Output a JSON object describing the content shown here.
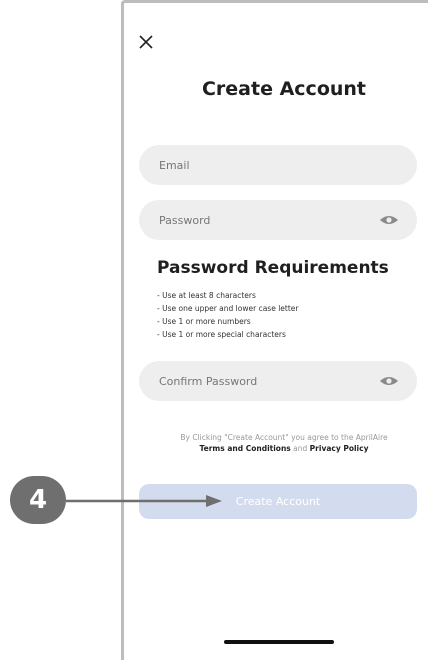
{
  "header": {
    "title": "Create Account"
  },
  "form": {
    "email_placeholder": "Email",
    "password_placeholder": "Password",
    "confirm_placeholder": "Confirm Password"
  },
  "requirements": {
    "title": "Password Requirements",
    "items": [
      "- Use at least 8 characters",
      "- Use one upper and lower case letter",
      "- Use 1 or more numbers",
      "- Use 1 or more special characters"
    ]
  },
  "legal": {
    "prefix": "By Clicking \"Create Account\" you agree to the AprilAire",
    "terms": "Terms and Conditions",
    "and": "and",
    "privacy": "Privacy Policy"
  },
  "cta": {
    "label": "Create Account"
  },
  "annotation": {
    "step": "4"
  },
  "colors": {
    "field_bg": "#eeeeee",
    "button_disabled": "#d3dcee",
    "callout": "#6f6f6f"
  }
}
